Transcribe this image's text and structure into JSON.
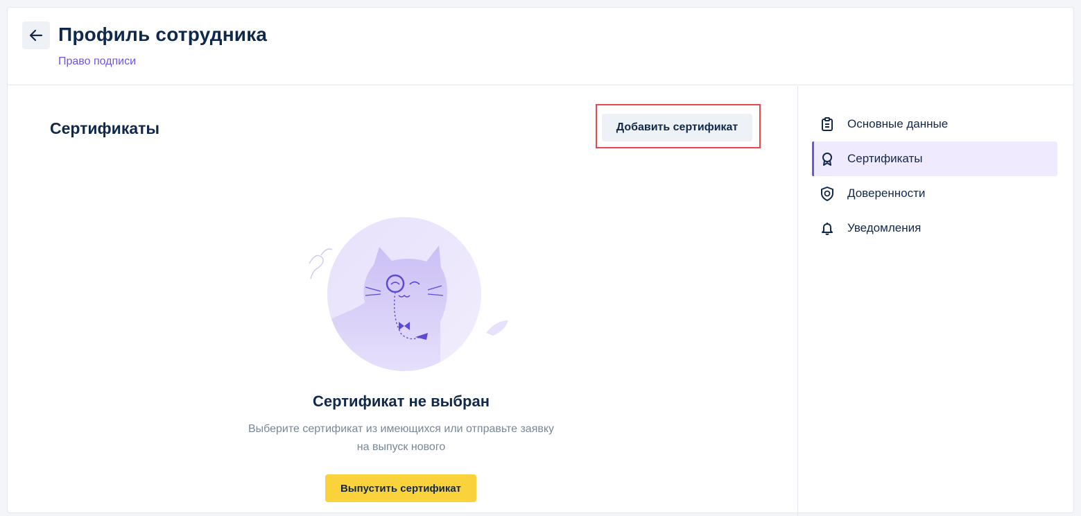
{
  "header": {
    "title": "Профиль сотрудника",
    "breadcrumb": "Право подписи"
  },
  "main": {
    "section_title": "Сертификаты",
    "add_button": "Добавить сертификат",
    "empty_state": {
      "title": "Сертификат не выбран",
      "description_line1": "Выберите сертификат из имеющихся или отправьте заявку",
      "description_line2": "на выпуск нового",
      "issue_button": "Выпустить сертификат"
    }
  },
  "sidebar": {
    "items": [
      {
        "label": "Основные данные",
        "icon": "clipboard-icon",
        "active": false
      },
      {
        "label": "Сертификаты",
        "icon": "award-icon",
        "active": true
      },
      {
        "label": "Доверенности",
        "icon": "shield-icon",
        "active": false
      },
      {
        "label": "Уведомления",
        "icon": "bell-icon",
        "active": false
      }
    ]
  },
  "colors": {
    "accent": "#6a55e6",
    "primary_button": "#fad23c",
    "highlight": "#e5484d",
    "text": "#10284a",
    "muted_text": "#7a8699"
  }
}
